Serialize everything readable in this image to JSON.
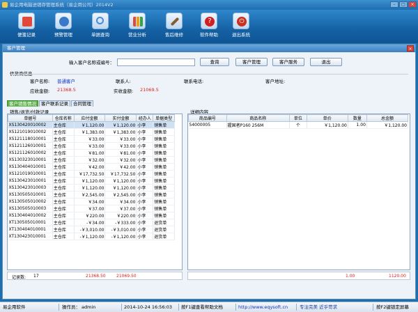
{
  "app": {
    "title": "易企用电脑进销存管理系统（易企用公司）2014V2"
  },
  "toolbar": [
    {
      "label": "便笺记录",
      "icon": "notepad-icon",
      "color": "#e04a3a"
    },
    {
      "label": "预警管理",
      "icon": "users-alert-icon",
      "color": "#3a78c8"
    },
    {
      "label": "单据查询",
      "icon": "magnifier-icon",
      "color": "#4a8ad8"
    },
    {
      "label": "营业分析",
      "icon": "bar-chart-icon",
      "color": "#e8a020"
    },
    {
      "label": "售后维修",
      "icon": "tools-icon",
      "color": "#8a5a30"
    },
    {
      "label": "软件帮助",
      "icon": "help-icon",
      "color": "#d02020"
    },
    {
      "label": "退出系统",
      "icon": "power-icon",
      "color": "#c83020"
    }
  ],
  "dialog": {
    "title": "客户管理",
    "search": {
      "label": "输入客户名称或编号：",
      "value": ""
    },
    "buttons": {
      "query": "查询",
      "customer_mgmt": "客户管理",
      "customer_service": "客户服务",
      "exit": "退出"
    },
    "supplier": {
      "header": "供货商信息",
      "name_label": "客户名称:",
      "name": "普通客户",
      "contact_label": "联系人:",
      "contact": "",
      "phone_label": "联系电话:",
      "phone": "",
      "address_label": "客户地址:",
      "address": "",
      "receivable_label": "应收金额:",
      "receivable": "21368.5",
      "received_label": "实收金额:",
      "received": "21069.5"
    },
    "tabs": [
      "客户销售情况",
      "客户联系记录",
      "合同管理"
    ],
    "left_panel": {
      "caption": "销售/退货/付款记录",
      "columns": [
        "单据号",
        "仓库名称",
        "应付金额",
        "实付金额",
        "经办人",
        "单据类型"
      ],
      "rows": [
        [
          "XS130420010002",
          "主仓库",
          "￥1,120.00",
          "￥1,120.00",
          "小李",
          "销售单"
        ],
        [
          "XS121019010002",
          "主仓库",
          "￥1,383.00",
          "￥1,383.00",
          "小李",
          "销售单"
        ],
        [
          "XS121118010001",
          "主仓库",
          "￥33.00",
          "￥33.00",
          "小李",
          "销售单"
        ],
        [
          "XS121126010001",
          "主仓库",
          "￥33.00",
          "￥33.00",
          "小李",
          "销售单"
        ],
        [
          "XS121126010002",
          "主仓库",
          "￥81.00",
          "￥81.00",
          "小李",
          "销售单"
        ],
        [
          "XS130323010001",
          "主仓库",
          "￥32.00",
          "￥32.00",
          "小李",
          "销售单"
        ],
        [
          "XS130404010001",
          "主仓库",
          "￥42.00",
          "￥42.00",
          "小李",
          "销售单"
        ],
        [
          "XS121019010001",
          "主仓库",
          "￥17,732.50",
          "￥17,732.50",
          "小李",
          "销售单"
        ],
        [
          "XS130423010001",
          "主仓库",
          "￥1,120.00",
          "￥1,120.00",
          "小李",
          "销售单"
        ],
        [
          "XS130423010003",
          "主仓库",
          "￥1,120.00",
          "￥1,120.00",
          "小李",
          "销售单"
        ],
        [
          "XS130505010001",
          "主仓库",
          "￥2,545.00",
          "￥2,545.00",
          "小李",
          "销售单"
        ],
        [
          "XS130505010002",
          "主仓库",
          "￥34.00",
          "￥34.00",
          "小李",
          "销售单"
        ],
        [
          "XS130505010003",
          "主仓库",
          "￥37.00",
          "￥37.00",
          "小李",
          "销售单"
        ],
        [
          "XS130404010002",
          "主仓库",
          "￥220.00",
          "￥220.00",
          "小李",
          "销售单"
        ],
        [
          "XT130505010001",
          "主仓库",
          "-￥34.00",
          "-￥333.00",
          "小李",
          "退货单"
        ],
        [
          "XT130404010001",
          "主仓库",
          "-￥3,010.00",
          "-￥3,010.00",
          "小李",
          "退货单"
        ],
        [
          "XT130423010001",
          "主仓库",
          "-￥1,120.00",
          "-￥1,120.00",
          "小李",
          "退货单"
        ]
      ],
      "footer_label": "记录数:",
      "record_count": "17",
      "total_payable": "21368.50",
      "total_paid": "21069.50"
    },
    "right_panel": {
      "caption": "详细内容",
      "columns": [
        "商品编号",
        "商品名称",
        "单位",
        "单价",
        "数量",
        "总金额"
      ],
      "rows": [
        [
          "54000005",
          "握国者P160 256M",
          "个",
          "￥1,120.00",
          "1.00",
          "￥1,120.00"
        ]
      ],
      "total_qty": "1.00",
      "total_amount": "1120.00"
    }
  },
  "statusbar": {
    "software": "易企用软件",
    "operator_label": "操作员：",
    "operator": "admin",
    "datetime": "2014-10-24 16:56:03",
    "help": "按F1键查看帮助文档",
    "url": "http://www.eqysoft.cn",
    "slogan": "专注完美 近乎苛求",
    "hotkey": "按F2键锁定屏幕"
  }
}
